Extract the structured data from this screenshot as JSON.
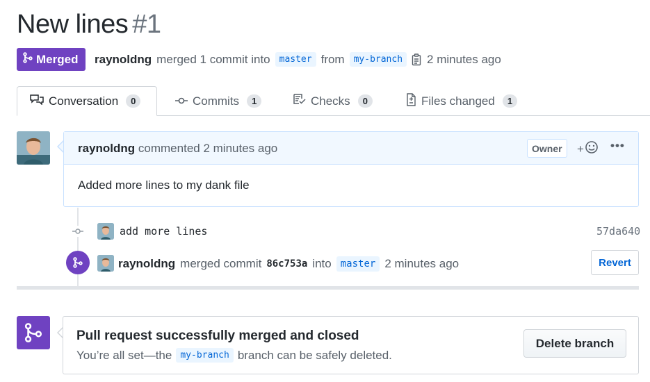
{
  "pr": {
    "title": "New lines",
    "number": "#1",
    "state_label": "Merged",
    "author": "raynoldng",
    "merged_text": "merged 1 commit into",
    "base_branch": "master",
    "from_text": "from",
    "head_branch": "my-branch",
    "time": "2 minutes ago"
  },
  "tabs": [
    {
      "label": "Conversation",
      "count": "0",
      "icon": "comment-discussion-icon"
    },
    {
      "label": "Commits",
      "count": "1",
      "icon": "git-commit-icon"
    },
    {
      "label": "Checks",
      "count": "0",
      "icon": "checklist-icon"
    },
    {
      "label": "Files changed",
      "count": "1",
      "icon": "file-diff-icon"
    }
  ],
  "comment": {
    "author": "raynoldng",
    "action": "commented 2 minutes ago",
    "badge": "Owner",
    "reaction_plus": "+",
    "more": "•••",
    "body": "Added more lines to my dank file"
  },
  "timeline": {
    "commit_message": "add more lines",
    "commit_sha": "57da640",
    "merge_author": "raynoldng",
    "merge_text": "merged commit",
    "merge_hash": "86c753a",
    "into_text": "into",
    "merge_branch": "master",
    "merge_time": "2 minutes ago",
    "revert_label": "Revert"
  },
  "merge_box": {
    "title": "Pull request successfully merged and closed",
    "sub_prefix": "You’re all set—the",
    "branch": "my-branch",
    "sub_suffix": "branch can be safely deleted.",
    "delete_label": "Delete branch"
  },
  "colors": {
    "merged_purple": "#6f42c1",
    "link_blue": "#0366d6",
    "ref_bg": "#eaf5ff"
  }
}
